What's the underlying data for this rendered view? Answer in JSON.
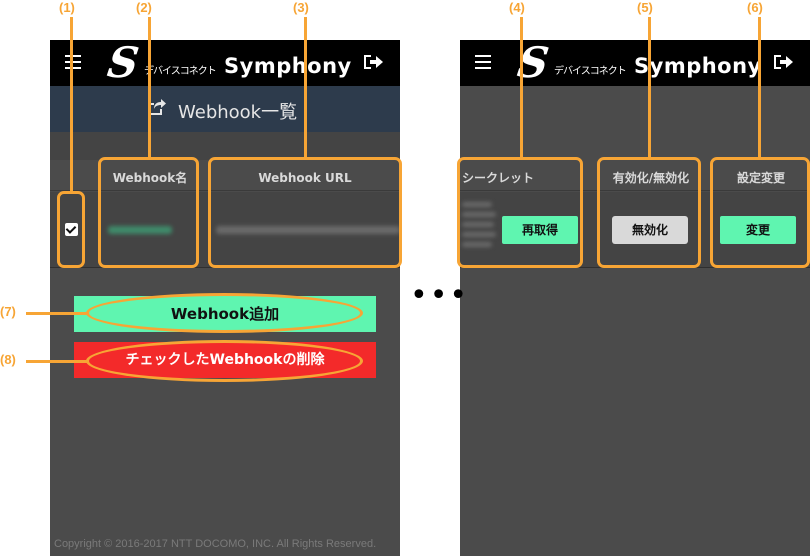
{
  "app": {
    "logo_mark": "S",
    "logo_subtitle": "デバイスコネクト",
    "logo_name": "Symphony"
  },
  "page_title": "Webhook一覧",
  "table": {
    "col_webhook_name": "Webhook名",
    "col_webhook_url": "Webhook URL",
    "col_secret": "シークレット",
    "col_enable_disable": "有効化/無効化",
    "col_settings": "設定変更"
  },
  "row": {
    "checked": true
  },
  "buttons": {
    "add_webhook": "Webhook追加",
    "delete_checked": "チェックしたWebhookの削除",
    "refetch": "再取得",
    "disable": "無効化",
    "change": "変更"
  },
  "footer": {
    "copyright": "Copyright © 2016-2017 NTT DOCOMO, INC. All Rights Reserved."
  },
  "annotations": {
    "label_1": "(1)",
    "label_2": "(2)",
    "label_3": "(3)",
    "label_4": "(4)",
    "label_5": "(5)",
    "label_6": "(6)",
    "label_7": "(7)",
    "label_8": "(8)"
  },
  "ellipsis": "•••",
  "colors": {
    "accent_annotation": "#f7a535",
    "add_button": "#5ff5b0",
    "delete_button": "#f32a2a",
    "disable_button": "#d9d9d9",
    "topbar": "#000000",
    "title_bar": "#2d3b4c",
    "background": "#4b4b4b"
  },
  "icons": {
    "menu": "hamburger-icon",
    "logout": "logout-icon",
    "title": "share-icon",
    "checkbox": "checkbox-checked-icon"
  }
}
